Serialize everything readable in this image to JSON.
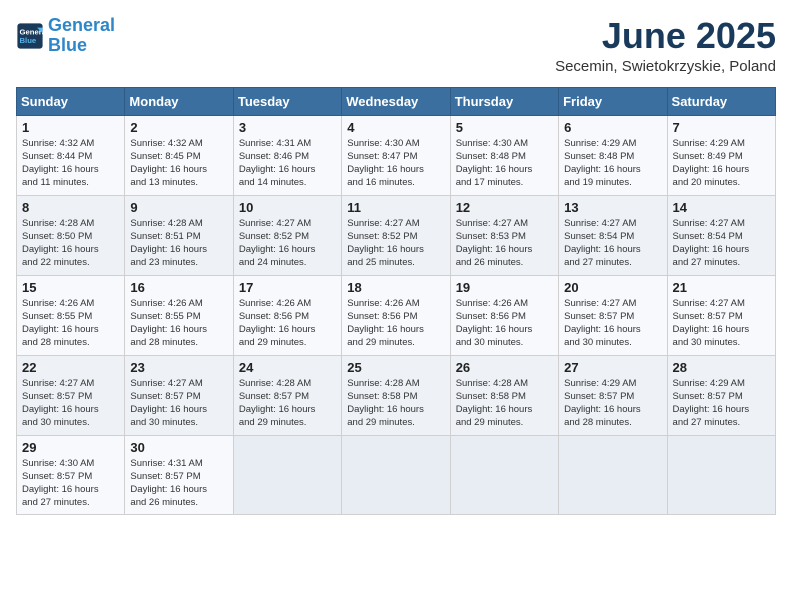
{
  "header": {
    "logo_line1": "General",
    "logo_line2": "Blue",
    "month_title": "June 2025",
    "location": "Secemin, Swietokrzyskie, Poland"
  },
  "weekdays": [
    "Sunday",
    "Monday",
    "Tuesday",
    "Wednesday",
    "Thursday",
    "Friday",
    "Saturday"
  ],
  "weeks": [
    [
      {
        "day": "1",
        "info": "Sunrise: 4:32 AM\nSunset: 8:44 PM\nDaylight: 16 hours\nand 11 minutes."
      },
      {
        "day": "2",
        "info": "Sunrise: 4:32 AM\nSunset: 8:45 PM\nDaylight: 16 hours\nand 13 minutes."
      },
      {
        "day": "3",
        "info": "Sunrise: 4:31 AM\nSunset: 8:46 PM\nDaylight: 16 hours\nand 14 minutes."
      },
      {
        "day": "4",
        "info": "Sunrise: 4:30 AM\nSunset: 8:47 PM\nDaylight: 16 hours\nand 16 minutes."
      },
      {
        "day": "5",
        "info": "Sunrise: 4:30 AM\nSunset: 8:48 PM\nDaylight: 16 hours\nand 17 minutes."
      },
      {
        "day": "6",
        "info": "Sunrise: 4:29 AM\nSunset: 8:48 PM\nDaylight: 16 hours\nand 19 minutes."
      },
      {
        "day": "7",
        "info": "Sunrise: 4:29 AM\nSunset: 8:49 PM\nDaylight: 16 hours\nand 20 minutes."
      }
    ],
    [
      {
        "day": "8",
        "info": "Sunrise: 4:28 AM\nSunset: 8:50 PM\nDaylight: 16 hours\nand 22 minutes."
      },
      {
        "day": "9",
        "info": "Sunrise: 4:28 AM\nSunset: 8:51 PM\nDaylight: 16 hours\nand 23 minutes."
      },
      {
        "day": "10",
        "info": "Sunrise: 4:27 AM\nSunset: 8:52 PM\nDaylight: 16 hours\nand 24 minutes."
      },
      {
        "day": "11",
        "info": "Sunrise: 4:27 AM\nSunset: 8:52 PM\nDaylight: 16 hours\nand 25 minutes."
      },
      {
        "day": "12",
        "info": "Sunrise: 4:27 AM\nSunset: 8:53 PM\nDaylight: 16 hours\nand 26 minutes."
      },
      {
        "day": "13",
        "info": "Sunrise: 4:27 AM\nSunset: 8:54 PM\nDaylight: 16 hours\nand 27 minutes."
      },
      {
        "day": "14",
        "info": "Sunrise: 4:27 AM\nSunset: 8:54 PM\nDaylight: 16 hours\nand 27 minutes."
      }
    ],
    [
      {
        "day": "15",
        "info": "Sunrise: 4:26 AM\nSunset: 8:55 PM\nDaylight: 16 hours\nand 28 minutes."
      },
      {
        "day": "16",
        "info": "Sunrise: 4:26 AM\nSunset: 8:55 PM\nDaylight: 16 hours\nand 28 minutes."
      },
      {
        "day": "17",
        "info": "Sunrise: 4:26 AM\nSunset: 8:56 PM\nDaylight: 16 hours\nand 29 minutes."
      },
      {
        "day": "18",
        "info": "Sunrise: 4:26 AM\nSunset: 8:56 PM\nDaylight: 16 hours\nand 29 minutes."
      },
      {
        "day": "19",
        "info": "Sunrise: 4:26 AM\nSunset: 8:56 PM\nDaylight: 16 hours\nand 30 minutes."
      },
      {
        "day": "20",
        "info": "Sunrise: 4:27 AM\nSunset: 8:57 PM\nDaylight: 16 hours\nand 30 minutes."
      },
      {
        "day": "21",
        "info": "Sunrise: 4:27 AM\nSunset: 8:57 PM\nDaylight: 16 hours\nand 30 minutes."
      }
    ],
    [
      {
        "day": "22",
        "info": "Sunrise: 4:27 AM\nSunset: 8:57 PM\nDaylight: 16 hours\nand 30 minutes."
      },
      {
        "day": "23",
        "info": "Sunrise: 4:27 AM\nSunset: 8:57 PM\nDaylight: 16 hours\nand 30 minutes."
      },
      {
        "day": "24",
        "info": "Sunrise: 4:28 AM\nSunset: 8:57 PM\nDaylight: 16 hours\nand 29 minutes."
      },
      {
        "day": "25",
        "info": "Sunrise: 4:28 AM\nSunset: 8:58 PM\nDaylight: 16 hours\nand 29 minutes."
      },
      {
        "day": "26",
        "info": "Sunrise: 4:28 AM\nSunset: 8:58 PM\nDaylight: 16 hours\nand 29 minutes."
      },
      {
        "day": "27",
        "info": "Sunrise: 4:29 AM\nSunset: 8:57 PM\nDaylight: 16 hours\nand 28 minutes."
      },
      {
        "day": "28",
        "info": "Sunrise: 4:29 AM\nSunset: 8:57 PM\nDaylight: 16 hours\nand 27 minutes."
      }
    ],
    [
      {
        "day": "29",
        "info": "Sunrise: 4:30 AM\nSunset: 8:57 PM\nDaylight: 16 hours\nand 27 minutes."
      },
      {
        "day": "30",
        "info": "Sunrise: 4:31 AM\nSunset: 8:57 PM\nDaylight: 16 hours\nand 26 minutes."
      },
      {
        "day": "",
        "info": ""
      },
      {
        "day": "",
        "info": ""
      },
      {
        "day": "",
        "info": ""
      },
      {
        "day": "",
        "info": ""
      },
      {
        "day": "",
        "info": ""
      }
    ]
  ]
}
